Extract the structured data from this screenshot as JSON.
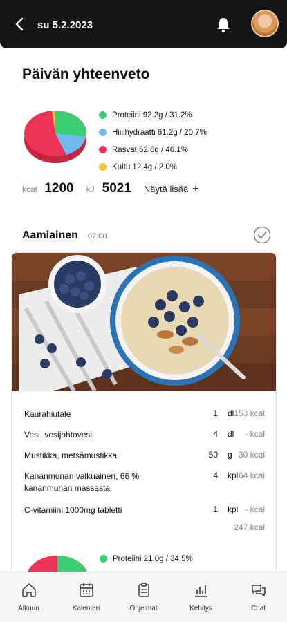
{
  "header": {
    "date": "su 5.2.2023"
  },
  "summary": {
    "title": "Päivän yhteenveto",
    "legend": [
      {
        "label": "Proteiini 92.2g / 31.2%",
        "color": "#3ccf72",
        "percent": 31.2
      },
      {
        "label": "Hiilihydraatti 61.2g / 20.7%",
        "color": "#74b8f2",
        "percent": 20.7
      },
      {
        "label": "Rasvat 62.6g / 46.1%",
        "color": "#ea3355",
        "percent": 46.1
      },
      {
        "label": "Kuitu 12.4g / 2.0%",
        "color": "#f5c041",
        "percent": 2.0
      }
    ],
    "kcal_unit": "kcal",
    "kcal_value": "1200",
    "kj_unit": "kJ",
    "kj_value": "5021",
    "more_label": "Näytä lisää",
    "plus": "+"
  },
  "meal": {
    "name": "Aamiainen",
    "time": "07:00",
    "items": [
      {
        "name": "Kaurahiutale",
        "amount": "1",
        "unit": "dl",
        "kcal": "153 kcal"
      },
      {
        "name": "Vesi, vesijohtovesi",
        "amount": "4",
        "unit": "dl",
        "kcal": "- kcal"
      },
      {
        "name": "Mustikka, metsämustikka",
        "amount": "50",
        "unit": "g",
        "kcal": "30 kcal"
      },
      {
        "name": "Kananmunan valkuainen, 66 % kananmunan massasta",
        "amount": "4",
        "unit": "kpl",
        "kcal": "64 kcal"
      },
      {
        "name": "C-vitamiini 1000mg tabletti",
        "amount": "1",
        "unit": "kpl",
        "kcal": "- kcal"
      }
    ],
    "total": "247 kcal",
    "legend": [
      {
        "label": "Proteiini 21.0g / 34.5%",
        "color": "#3ccf72"
      }
    ]
  },
  "nav": [
    {
      "label": "Alkuun",
      "icon": "home-icon"
    },
    {
      "label": "Kalenteri",
      "icon": "calendar-icon"
    },
    {
      "label": "Ohjelmat",
      "icon": "clipboard-icon"
    },
    {
      "label": "Kehitys",
      "icon": "chart-icon"
    },
    {
      "label": "Chat",
      "icon": "chat-icon"
    }
  ]
}
